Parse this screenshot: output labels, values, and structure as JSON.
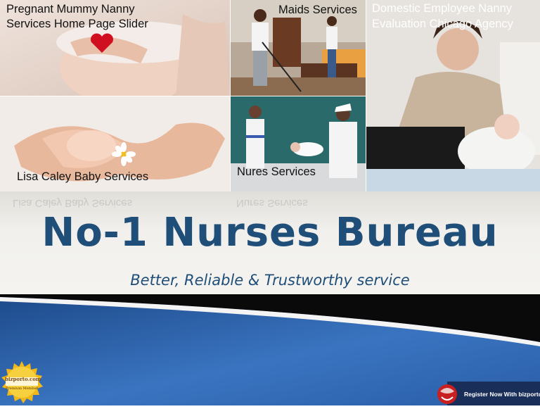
{
  "tiles": {
    "pregnant": {
      "label_line1": "Pregnant Mummy Nanny",
      "label_line2": "Services Home Page Slider"
    },
    "maids": {
      "label": "Maids Services"
    },
    "domestic": {
      "label_line1": "Domestic Employee Nanny",
      "label_line2": "Evaluation Chicago Agency"
    },
    "baby": {
      "label": "Lisa Caley Baby Services",
      "reflection": "Lisa Caley Baby Services"
    },
    "nurses": {
      "label": "Nures Services",
      "reflection": "Nures Services"
    }
  },
  "title": "No-1 Nurses Bureau",
  "tagline": "Better, Reliable & Trustworthy service",
  "seal": {
    "brand": "bizporto",
    "brand_suffix": ".com",
    "caption": "Premium Member"
  },
  "register": {
    "label": "Register Now With bizporto"
  },
  "colors": {
    "title": "#1f4e79",
    "footer_blue": "#2e62a8",
    "footer_dark": "#0a0a0a"
  }
}
